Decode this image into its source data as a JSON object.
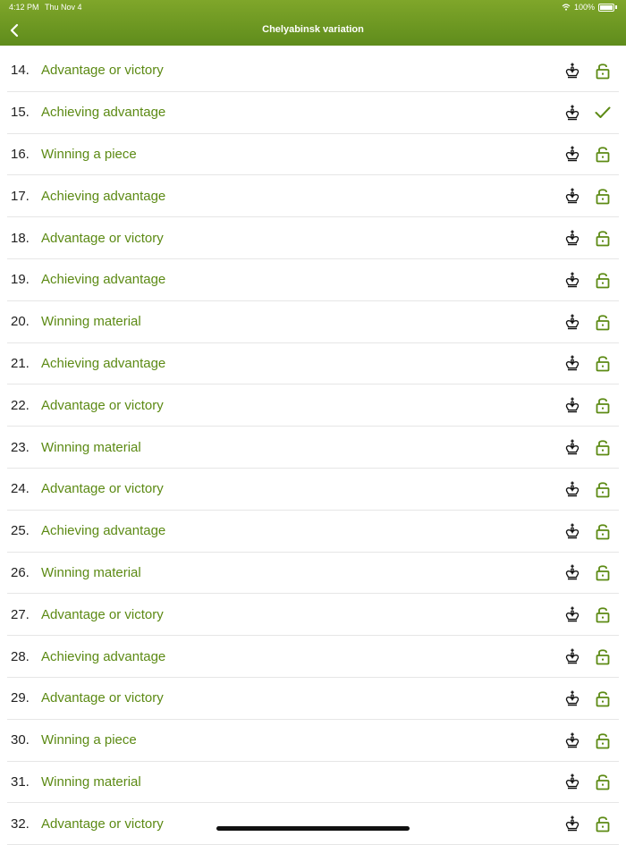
{
  "status": {
    "time": "4:12 PM",
    "date": "Thu Nov 4",
    "battery": "100%"
  },
  "nav": {
    "title": "Chelyabinsk variation"
  },
  "items": [
    {
      "num": "14.",
      "label": "Advantage or victory",
      "state": "locked"
    },
    {
      "num": "15.",
      "label": "Achieving advantage",
      "state": "done"
    },
    {
      "num": "16.",
      "label": "Winning a piece",
      "state": "locked"
    },
    {
      "num": "17.",
      "label": "Achieving advantage",
      "state": "locked"
    },
    {
      "num": "18.",
      "label": "Advantage or victory",
      "state": "locked"
    },
    {
      "num": "19.",
      "label": "Achieving advantage",
      "state": "locked"
    },
    {
      "num": "20.",
      "label": "Winning material",
      "state": "locked"
    },
    {
      "num": "21.",
      "label": "Achieving advantage",
      "state": "locked"
    },
    {
      "num": "22.",
      "label": "Advantage or victory",
      "state": "locked"
    },
    {
      "num": "23.",
      "label": "Winning material",
      "state": "locked"
    },
    {
      "num": "24.",
      "label": "Advantage or victory",
      "state": "locked"
    },
    {
      "num": "25.",
      "label": "Achieving advantage",
      "state": "locked"
    },
    {
      "num": "26.",
      "label": "Winning material",
      "state": "locked"
    },
    {
      "num": "27.",
      "label": "Advantage or victory",
      "state": "locked"
    },
    {
      "num": "28.",
      "label": "Achieving advantage",
      "state": "locked"
    },
    {
      "num": "29.",
      "label": "Advantage or victory",
      "state": "locked"
    },
    {
      "num": "30.",
      "label": "Winning a piece",
      "state": "locked"
    },
    {
      "num": "31.",
      "label": "Winning material",
      "state": "locked"
    },
    {
      "num": "32.",
      "label": "Advantage or victory",
      "state": "locked"
    }
  ],
  "colors": {
    "accent": "#5c8a14",
    "bar": "#6f9a22"
  }
}
